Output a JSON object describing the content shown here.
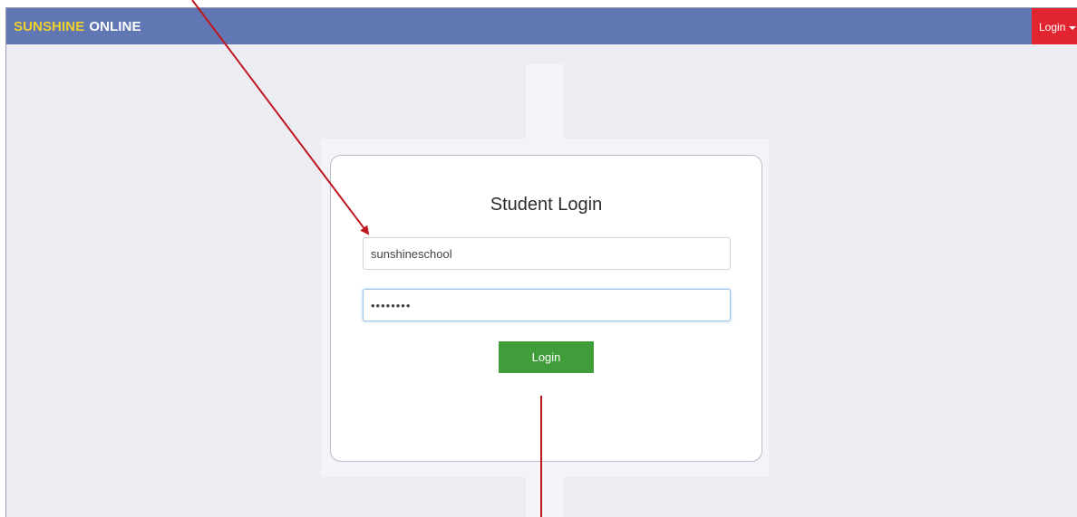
{
  "navbar": {
    "brand_part1": "SUNSHINE",
    "brand_part2": "ONLINE",
    "login_menu_label": "Login"
  },
  "login_card": {
    "title": "Student Login",
    "username_value": "sunshineschool",
    "password_value": "sunshine",
    "button_label": "Login"
  },
  "colors": {
    "navbar": "#6077b3",
    "brand_accent": "#f0d02a",
    "login_menu": "#e12530",
    "login_button": "#3f9e3a",
    "annotation": "#c0161f"
  }
}
